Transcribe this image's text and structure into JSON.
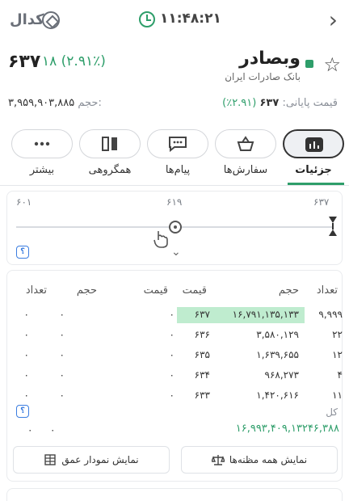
{
  "topbar": {
    "brand": "کدال",
    "time": "۱۱:۴۸:۲۱"
  },
  "symbol": {
    "name": "وبصادر",
    "company": "بانک صادرات ایران",
    "last_price": "۶۳۷",
    "change": "۱۸",
    "change_pct": "(۲.۹۱٪)",
    "close_label": "قیمت پایانی:",
    "close_price": "۶۳۷",
    "close_pct": "(۲.۹۱٪)",
    "volume_label": "حجم:",
    "volume": "۳,۹۵۹,۹۰۳,۸۸۵"
  },
  "tabs": [
    {
      "label": "جزئیات",
      "icon": "bar-chart-icon"
    },
    {
      "label": "سفارش‌ها",
      "icon": "basket-icon"
    },
    {
      "label": "پیام‌ها",
      "icon": "chat-icon"
    },
    {
      "label": "همگروهی",
      "icon": "compare-icon"
    },
    {
      "label": "بیشتر",
      "icon": "more-dots-icon"
    }
  ],
  "range": {
    "low": "۶۰۱",
    "mid": "۶۱۹",
    "high": "۶۳۷",
    "help": "؟"
  },
  "orderbook": {
    "headers": {
      "count_buy": "تعداد",
      "volume_buy": "حجم",
      "price_buy": "قیمت",
      "price_sell": "قیمت",
      "volume_sell": "حجم",
      "count_sell": "تعداد"
    },
    "rows": [
      {
        "count": "۹,۹۹۹",
        "volume": "۱۶,۷۹۱,۱۳۵,۱۳۳",
        "price": "۶۳۷",
        "s_price": "۰",
        "s_volume": "۰",
        "s_count": "۰"
      },
      {
        "count": "۲۲",
        "volume": "۳,۵۸۰,۱۲۹",
        "price": "۶۳۶",
        "s_price": "۰",
        "s_volume": "۰",
        "s_count": "۰"
      },
      {
        "count": "۱۲",
        "volume": "۱,۶۳۹,۶۵۵",
        "price": "۶۳۵",
        "s_price": "۰",
        "s_volume": "۰",
        "s_count": "۰"
      },
      {
        "count": "۴",
        "volume": "۹۶۸,۲۷۳",
        "price": "۶۳۴",
        "s_price": "۰",
        "s_volume": "۰",
        "s_count": "۰"
      },
      {
        "count": "۱۱",
        "volume": "۱,۴۲۰,۶۱۶",
        "price": "۶۳۳",
        "s_price": "۰",
        "s_volume": "۰",
        "s_count": "۰"
      }
    ],
    "total_label": "کل",
    "total_buy": "۱۶,۹۹۳,۴۰۹,۱۳۲۴۶,۳۸۸",
    "total_sell_volume": "۰",
    "total_sell_count": "۰",
    "help": "؟"
  },
  "buttons": {
    "all_suspects": "نمایش همه مظنه‌ها",
    "depth_chart": "نمایش نمودار عمق"
  },
  "colors": {
    "green": "#2e9e6a",
    "highlight": "#bfeccf",
    "help_blue": "#3b7de0"
  }
}
